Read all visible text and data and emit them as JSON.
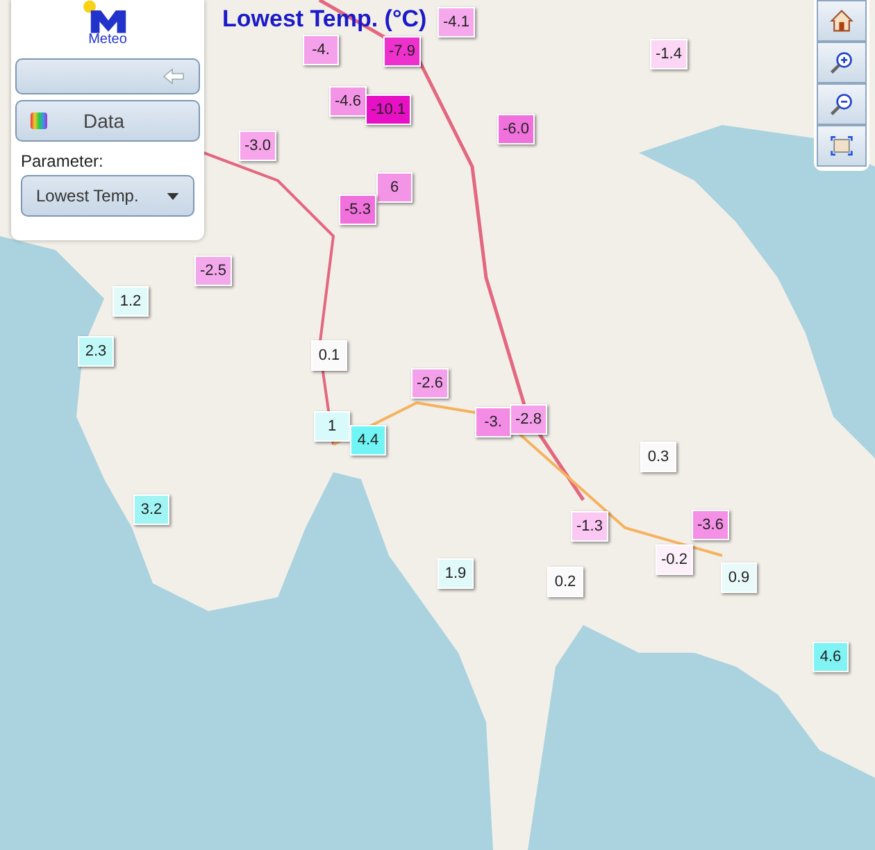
{
  "map_title": "Lowest Temp. (°C)",
  "panel": {
    "logo_text": "Meteo",
    "data_button": "Data",
    "parameter_label": "Parameter:",
    "parameter_value": "Lowest Temp."
  },
  "markers": [
    {
      "value": "-4.",
      "color": "#f4a0ea"
    },
    {
      "value": "-7.9",
      "color": "#ee30cc"
    },
    {
      "value": "-4.1",
      "color": "#f6a8ec"
    },
    {
      "value": "-1.4",
      "color": "#fbd6f5"
    },
    {
      "value": "-4.6",
      "color": "#f494e6"
    },
    {
      "value": "-10.1",
      "color": "#e810c4"
    },
    {
      "value": "-6.0",
      "color": "#f070dc"
    },
    {
      "value": "-3.0",
      "color": "#f7a6ec"
    },
    {
      "value": "6",
      "color": "#f494e6"
    },
    {
      "value": "-5.3",
      "color": "#f070dc"
    },
    {
      "value": "-2.5",
      "color": "#f4a8ec"
    },
    {
      "value": "1.2",
      "color": "#e0fafa"
    },
    {
      "value": "2.3",
      "color": "#c0f8f8"
    },
    {
      "value": "0.1",
      "color": "#fafafa"
    },
    {
      "value": "-2.6",
      "color": "#f4a0ea"
    },
    {
      "value": "1",
      "color": "#d8fafa"
    },
    {
      "value": "4.4",
      "color": "#70f4f4"
    },
    {
      "value": "-3.",
      "color": "#f48ce6"
    },
    {
      "value": "-2.8",
      "color": "#f4a0ea"
    },
    {
      "value": "0.3",
      "color": "#fafafa"
    },
    {
      "value": "3.2",
      "color": "#a0f4f4"
    },
    {
      "value": "-1.3",
      "color": "#fbc8f3"
    },
    {
      "value": "-3.6",
      "color": "#f490e6"
    },
    {
      "value": "-0.2",
      "color": "#fdf0fb"
    },
    {
      "value": "1.9",
      "color": "#e0fafa"
    },
    {
      "value": "0.2",
      "color": "#fafafa"
    },
    {
      "value": "0.9",
      "color": "#e8fafa"
    },
    {
      "value": "4.6",
      "color": "#80f4f4"
    }
  ]
}
